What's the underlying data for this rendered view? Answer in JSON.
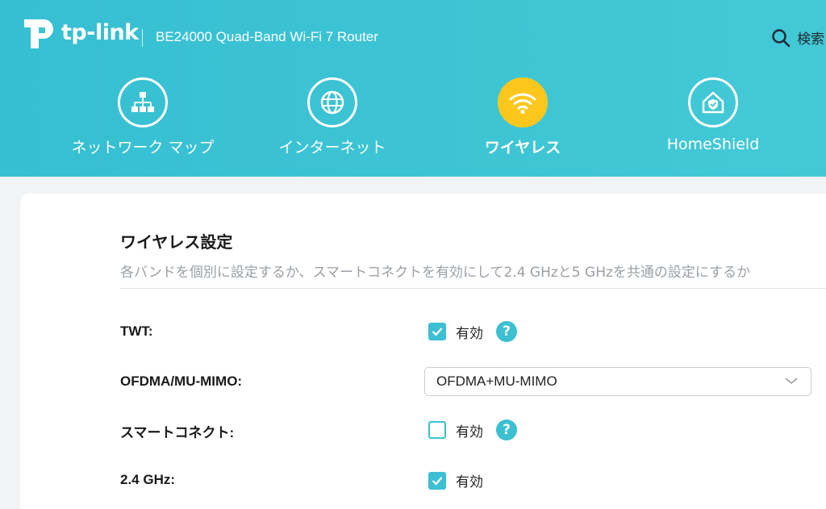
{
  "header": {
    "brand": "tp-link",
    "model": "BE24000 Quad-Band Wi-Fi 7 Router",
    "search_label": "検索",
    "colors": {
      "bg": "#3ec4d4",
      "active_tab": "#fcc71d"
    }
  },
  "nav": {
    "items": [
      {
        "label": "ネットワーク マップ",
        "icon": "network-map-icon"
      },
      {
        "label": "インターネット",
        "icon": "globe-icon"
      },
      {
        "label": "ワイヤレス",
        "icon": "wifi-icon",
        "active": true
      },
      {
        "label": "HomeShield",
        "icon": "homeshield-icon"
      }
    ]
  },
  "wireless": {
    "title": "ワイヤレス設定",
    "description": "各バンドを個別に設定するか、スマートコネクトを有効にして2.4 GHzと5 GHzを共通の設定にするか",
    "rows": [
      {
        "label": "TWT:",
        "option_label": "有効",
        "checked": true,
        "help": "?"
      },
      {
        "label": "OFDMA/MU-MIMO:",
        "value": "OFDMA+MU-MIMO"
      },
      {
        "label": "スマートコネクト:",
        "option_label": "有効",
        "checked": false,
        "help": "?"
      },
      {
        "label": "2.4 GHz:",
        "option_label": "有効",
        "checked": true
      }
    ]
  }
}
